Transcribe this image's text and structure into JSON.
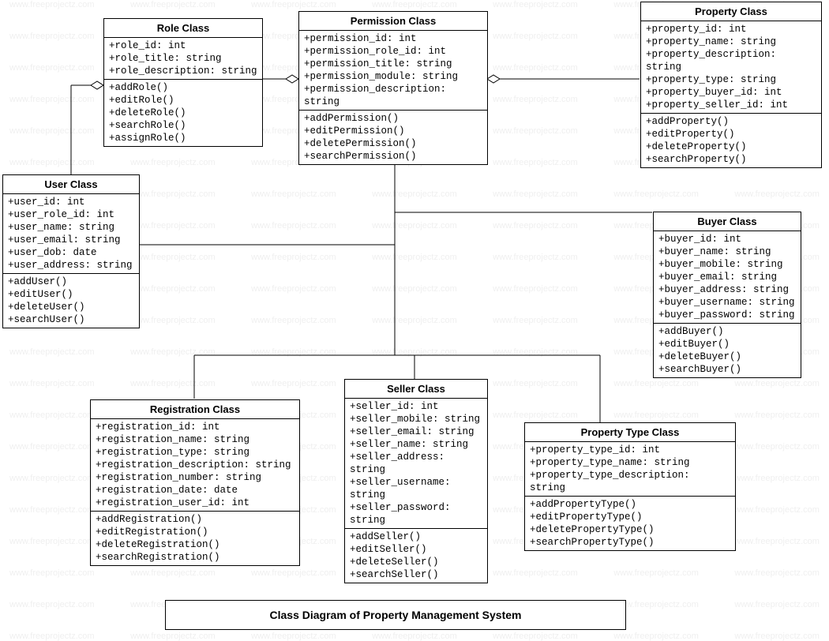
{
  "diagram_title": "Class Diagram of Property Management System",
  "watermark_text": "www.freeprojectz.com",
  "classes": {
    "role": {
      "title": "Role Class",
      "attrs": [
        "+role_id: int",
        "+role_title: string",
        "+role_description: string"
      ],
      "ops": [
        "+addRole()",
        "+editRole()",
        "+deleteRole()",
        "+searchRole()",
        "+assignRole()"
      ]
    },
    "permission": {
      "title": "Permission Class",
      "attrs": [
        "+permission_id: int",
        "+permission_role_id: int",
        "+permission_title: string",
        "+permission_module: string",
        "+permission_description: string"
      ],
      "ops": [
        "+addPermission()",
        "+editPermission()",
        "+deletePermission()",
        "+searchPermission()"
      ]
    },
    "property": {
      "title": "Property Class",
      "attrs": [
        "+property_id: int",
        "+property_name: string",
        "+property_description: string",
        "+property_type: string",
        "+property_buyer_id: int",
        "+property_seller_id: int"
      ],
      "ops": [
        "+addProperty()",
        "+editProperty()",
        "+deleteProperty()",
        "+searchProperty()"
      ]
    },
    "user": {
      "title": "User Class",
      "attrs": [
        "+user_id: int",
        "+user_role_id: int",
        "+user_name: string",
        "+user_email: string",
        "+user_dob: date",
        "+user_address: string"
      ],
      "ops": [
        "+addUser()",
        "+editUser()",
        "+deleteUser()",
        "+searchUser()"
      ]
    },
    "buyer": {
      "title": "Buyer Class",
      "attrs": [
        "+buyer_id: int",
        "+buyer_name: string",
        "+buyer_mobile: string",
        "+buyer_email: string",
        "+buyer_address: string",
        "+buyer_username: string",
        "+buyer_password: string"
      ],
      "ops": [
        "+addBuyer()",
        "+editBuyer()",
        "+deleteBuyer()",
        "+searchBuyer()"
      ]
    },
    "seller": {
      "title": "Seller Class",
      "attrs": [
        "+seller_id: int",
        "+seller_mobile: string",
        "+seller_email: string",
        "+seller_name: string",
        "+seller_address: string",
        "+seller_username: string",
        "+seller_password: string"
      ],
      "ops": [
        "+addSeller()",
        "+editSeller()",
        "+deleteSeller()",
        "+searchSeller()"
      ]
    },
    "registration": {
      "title": "Registration Class",
      "attrs": [
        "+registration_id: int",
        "+registration_name: string",
        "+registration_type: string",
        "+registration_description: string",
        "+registration_number: string",
        "+registration_date: date",
        "+registration_user_id: int"
      ],
      "ops": [
        "+addRegistration()",
        "+editRegistration()",
        "+deleteRegistration()",
        "+searchRegistration()"
      ]
    },
    "property_type": {
      "title": "Property Type Class",
      "attrs": [
        "+property_type_id: int",
        "+property_type_name: string",
        "+property_type_description: string"
      ],
      "ops": [
        "+addPropertyType()",
        "+editPropertyType()",
        "+deletePropertyType()",
        "+searchPropertyType()"
      ]
    }
  }
}
